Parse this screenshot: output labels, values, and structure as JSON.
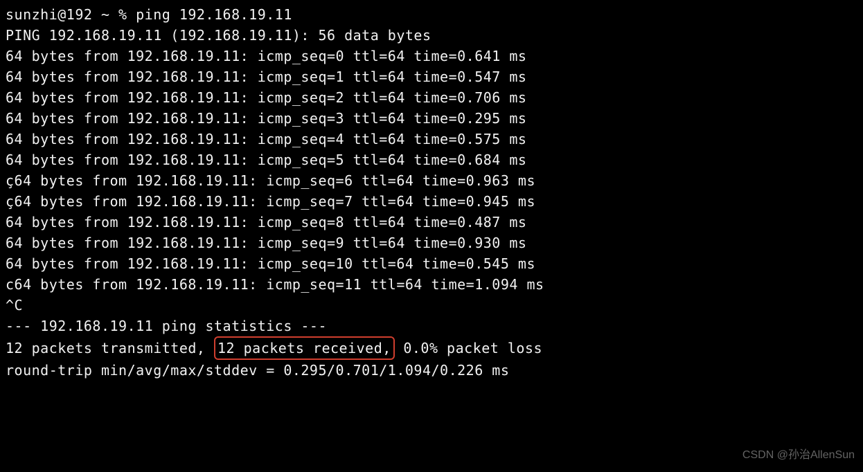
{
  "prompt_line": "sunzhi@192 ~ % ping 192.168.19.11",
  "ping_header": "PING 192.168.19.11 (192.168.19.11): 56 data bytes",
  "ping_replies": [
    "64 bytes from 192.168.19.11: icmp_seq=0 ttl=64 time=0.641 ms",
    "64 bytes from 192.168.19.11: icmp_seq=1 ttl=64 time=0.547 ms",
    "64 bytes from 192.168.19.11: icmp_seq=2 ttl=64 time=0.706 ms",
    "64 bytes from 192.168.19.11: icmp_seq=3 ttl=64 time=0.295 ms",
    "64 bytes from 192.168.19.11: icmp_seq=4 ttl=64 time=0.575 ms",
    "64 bytes from 192.168.19.11: icmp_seq=5 ttl=64 time=0.684 ms",
    "ç64 bytes from 192.168.19.11: icmp_seq=6 ttl=64 time=0.963 ms",
    "ç64 bytes from 192.168.19.11: icmp_seq=7 ttl=64 time=0.945 ms",
    "64 bytes from 192.168.19.11: icmp_seq=8 ttl=64 time=0.487 ms",
    "64 bytes from 192.168.19.11: icmp_seq=9 ttl=64 time=0.930 ms",
    "64 bytes from 192.168.19.11: icmp_seq=10 ttl=64 time=0.545 ms",
    "c64 bytes from 192.168.19.11: icmp_seq=11 ttl=64 time=1.094 ms"
  ],
  "interrupt": "^C",
  "stats_header": "--- 192.168.19.11 ping statistics ---",
  "stats_line": {
    "before": "12 packets transmitted, ",
    "highlighted": "12 packets received,",
    "after": " 0.0% packet loss"
  },
  "rtt_line": "round-trip min/avg/max/stddev = 0.295/0.701/1.094/0.226 ms",
  "watermark": "CSDN @孙治AllenSun"
}
